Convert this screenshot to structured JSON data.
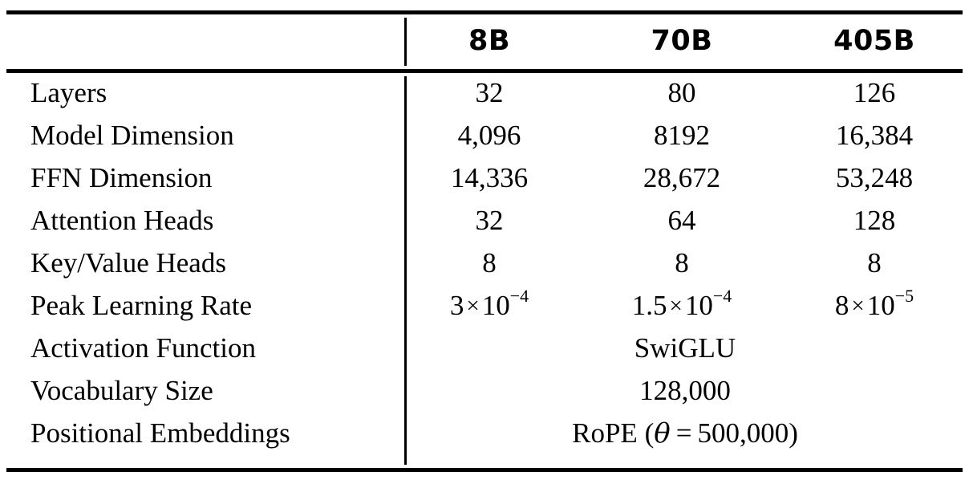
{
  "table": {
    "columns": [
      "",
      "8B",
      "70B",
      "405B"
    ],
    "rows": [
      {
        "label": "Layers",
        "span": false,
        "values": [
          "32",
          "80",
          "126"
        ]
      },
      {
        "label": "Model Dimension",
        "span": false,
        "values": [
          "4,096",
          "8192",
          "16,384"
        ]
      },
      {
        "label": "FFN Dimension",
        "span": false,
        "values": [
          "14,336",
          "28,672",
          "53,248"
        ]
      },
      {
        "label": "Attention Heads",
        "span": false,
        "values": [
          "32",
          "64",
          "128"
        ]
      },
      {
        "label": "Key/Value Heads",
        "span": false,
        "values": [
          "8",
          "8",
          "8"
        ]
      },
      {
        "label": "Peak Learning Rate",
        "span": false,
        "values": [
          "3 × 10⁻⁴",
          "1.5 × 10⁻⁴",
          "8 × 10⁻⁵"
        ]
      },
      {
        "label": "Activation Function",
        "span": true,
        "value": "SwiGLU"
      },
      {
        "label": "Vocabulary Size",
        "span": true,
        "value": "128,000"
      },
      {
        "label": "Positional Embeddings",
        "span": true,
        "value": "RoPE (θ = 500,000)"
      }
    ],
    "learning_rate_parts": {
      "c1": {
        "mantissa": "3",
        "times": "×",
        "base": "10",
        "exponent": "−4"
      },
      "c2": {
        "mantissa": "1.5",
        "times": "×",
        "base": "10",
        "exponent": "−4"
      },
      "c3": {
        "mantissa": "8",
        "times": "×",
        "base": "10",
        "exponent": "−5"
      }
    },
    "rope_parts": {
      "prefix": "RoPE (",
      "theta": "θ",
      "equals": "=",
      "value": "500,000",
      "suffix": ")"
    },
    "colors": {
      "rule": "#000000",
      "text": "#000000",
      "background": "#ffffff"
    }
  }
}
